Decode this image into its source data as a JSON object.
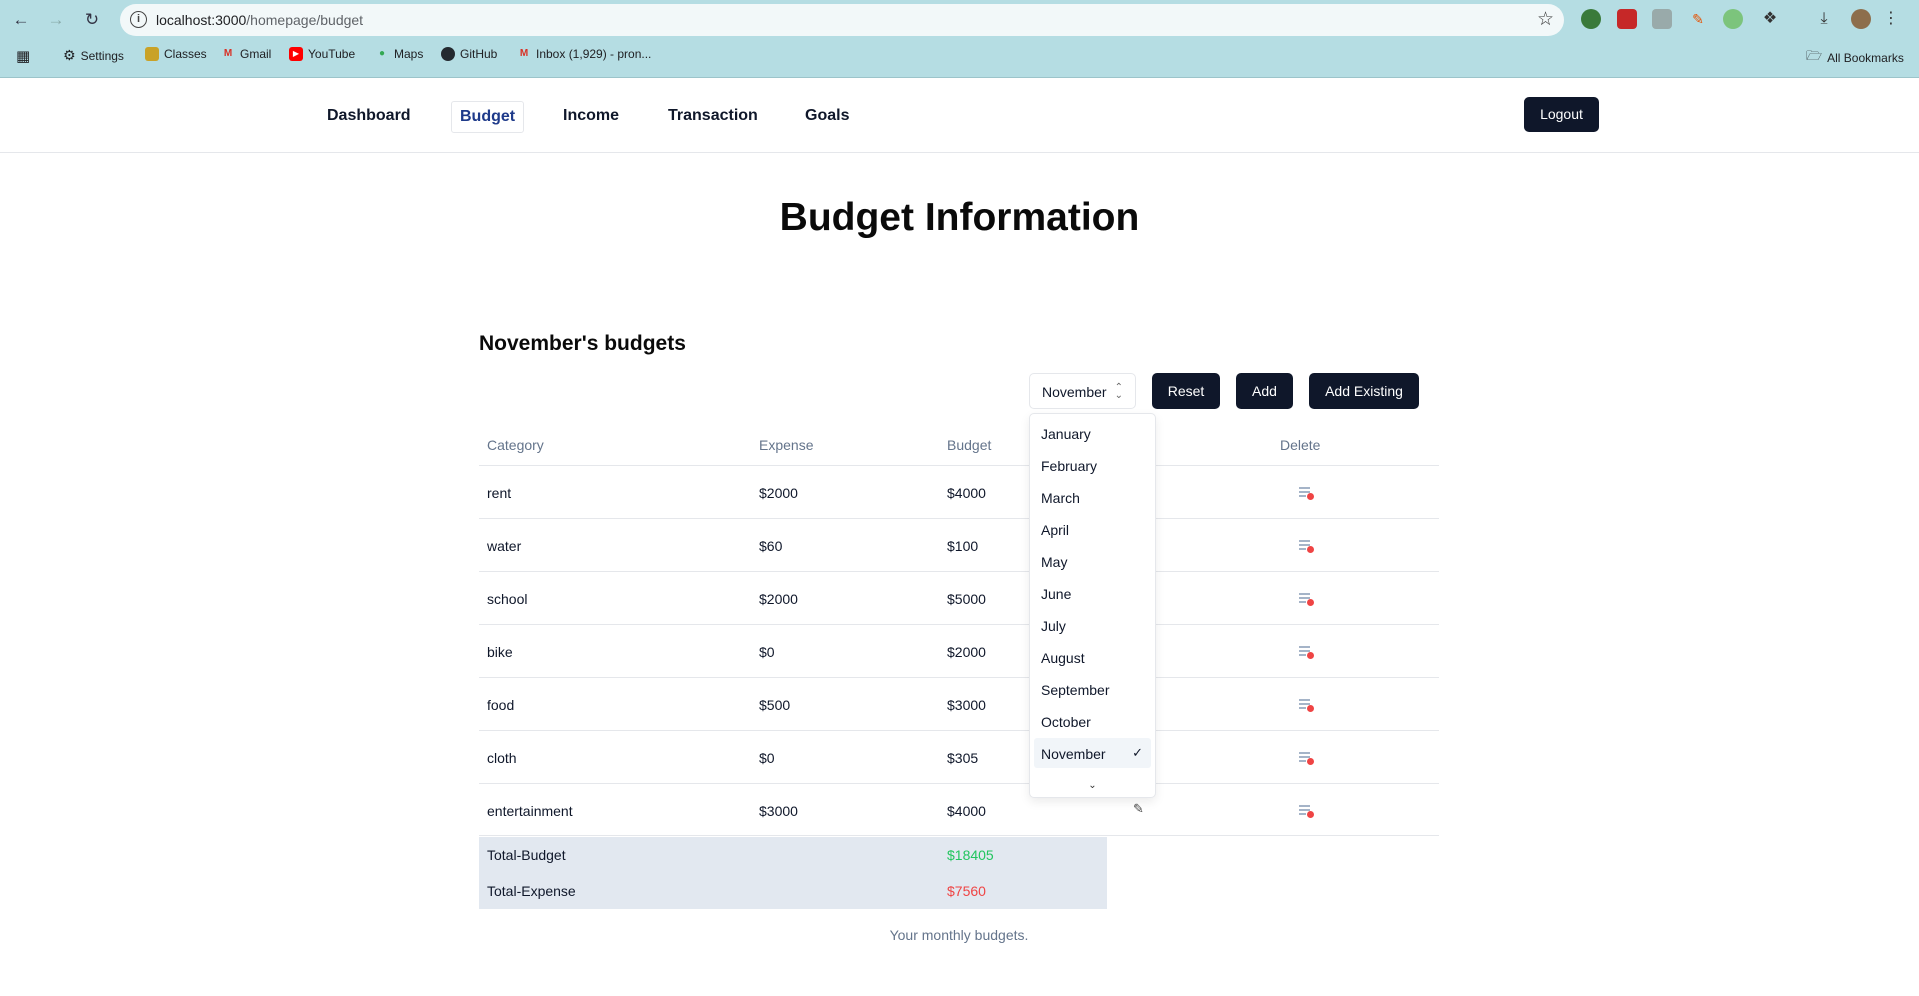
{
  "browser": {
    "url_host": "localhost:3000",
    "url_path": "/homepage/budget",
    "bookmarks": [
      {
        "label": "Settings",
        "icon": "gear-icon"
      },
      {
        "label": "Classes",
        "icon": "classes-icon"
      },
      {
        "label": "Gmail",
        "icon": "gmail-icon"
      },
      {
        "label": "YouTube",
        "icon": "youtube-icon"
      },
      {
        "label": "Maps",
        "icon": "maps-icon"
      },
      {
        "label": "GitHub",
        "icon": "github-icon"
      },
      {
        "label": "Inbox (1,929) - pron...",
        "icon": "gmail-icon"
      }
    ],
    "all_bookmarks": "All Bookmarks"
  },
  "nav": {
    "items": [
      "Dashboard",
      "Budget",
      "Income",
      "Transaction",
      "Goals"
    ],
    "active": "Budget",
    "logout": "Logout"
  },
  "page": {
    "title": "Budget Information",
    "section_title": "November's budgets",
    "month_selected": "November",
    "buttons": {
      "reset": "Reset",
      "add": "Add",
      "add_existing": "Add Existing"
    },
    "caption": "Your monthly budgets."
  },
  "table": {
    "headers": {
      "category": "Category",
      "expense": "Expense",
      "budget": "Budget",
      "delete": "Delete"
    },
    "rows": [
      {
        "category": "rent",
        "expense": "$2000",
        "budget": "$4000"
      },
      {
        "category": "water",
        "expense": "$60",
        "budget": "$100"
      },
      {
        "category": "school",
        "expense": "$2000",
        "budget": "$5000"
      },
      {
        "category": "bike",
        "expense": "$0",
        "budget": "$2000"
      },
      {
        "category": "food",
        "expense": "$500",
        "budget": "$3000"
      },
      {
        "category": "cloth",
        "expense": "$0",
        "budget": "$305"
      },
      {
        "category": "entertainment",
        "expense": "$3000",
        "budget": "$4000"
      }
    ],
    "totals": {
      "budget_label": "Total-Budget",
      "budget_value": "$18405",
      "expense_label": "Total-Expense",
      "expense_value": "$7560"
    }
  },
  "dropdown": {
    "options": [
      "January",
      "February",
      "March",
      "April",
      "May",
      "June",
      "July",
      "August",
      "September",
      "October",
      "November"
    ],
    "selected": "November",
    "check": "✓"
  },
  "colors": {
    "primary": "#0f172a",
    "active_nav": "#1e3a8a",
    "total_budget": "#22c55e",
    "total_expense": "#ef4444",
    "footer_bg": "#e2e8f0"
  }
}
